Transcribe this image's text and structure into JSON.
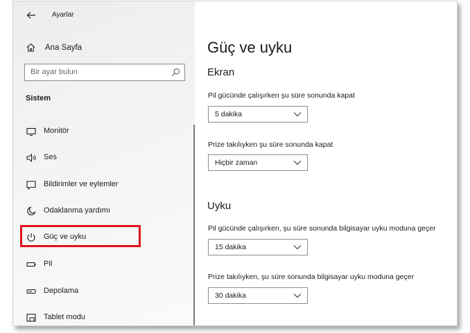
{
  "window": {
    "title": "Ayarlar"
  },
  "sidebar": {
    "home_label": "Ana Sayfa",
    "search_placeholder": "Bir ayar bulun",
    "section_heading": "Sistem",
    "items": [
      {
        "label": "Monitör",
        "icon": "monitor-icon"
      },
      {
        "label": "Ses",
        "icon": "speaker-icon"
      },
      {
        "label": "Bildirimler ve eylemler",
        "icon": "notification-icon"
      },
      {
        "label": "Odaklanma yardımı",
        "icon": "moon-icon"
      },
      {
        "label": "Güç ve uyku",
        "icon": "power-icon",
        "selected": true
      },
      {
        "label": "Pil",
        "icon": "battery-icon"
      },
      {
        "label": "Depolama",
        "icon": "storage-icon"
      },
      {
        "label": "Tablet modu",
        "icon": "tablet-icon"
      }
    ]
  },
  "main": {
    "title": "Güç ve uyku",
    "screen": {
      "heading": "Ekran",
      "settings": [
        {
          "label": "Pil gücünde çalışırken şu süre sonunda kapat",
          "value": "5 dakika"
        },
        {
          "label": "Prize takılıyken şu süre sonunda kapat",
          "value": "Hiçbir zaman"
        }
      ]
    },
    "sleep": {
      "heading": "Uyku",
      "settings": [
        {
          "label": "Pil gücünde çalışırken, şu süre sonunda bilgisayar uyku moduna geçer",
          "value": "15 dakika"
        },
        {
          "label": "Prize takılıyken, şu süre sonunda bilgisayar uyku moduna geçer",
          "value": "30 dakika"
        }
      ]
    }
  },
  "colors": {
    "highlight": "#e0121b",
    "sidebar_bg": "#eeeff0",
    "text": "#1a1a1a"
  }
}
